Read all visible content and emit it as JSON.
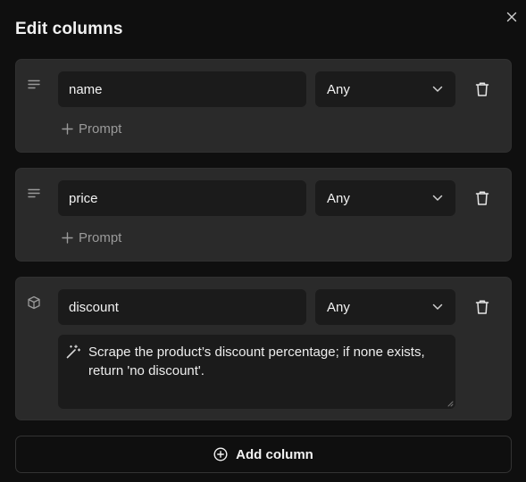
{
  "dialog": {
    "title": "Edit columns",
    "close_icon": "close-icon"
  },
  "columns": [
    {
      "type_icon": "text-align-icon",
      "name": "name",
      "type": "Any",
      "prompt_button_label": "Prompt"
    },
    {
      "type_icon": "text-align-icon",
      "name": "price",
      "type": "Any",
      "prompt_button_label": "Prompt"
    },
    {
      "type_icon": "cube-icon",
      "name": "discount",
      "type": "Any",
      "prompt_text": "Scrape the product’s discount percentage; if none exists, return 'no discount'."
    }
  ],
  "footer": {
    "add_column_label": "Add column"
  },
  "colors": {
    "background": "#0f0f0f",
    "card": "#2a2a2a",
    "input": "#1b1b1b",
    "muted_text": "#9a9a9a"
  }
}
